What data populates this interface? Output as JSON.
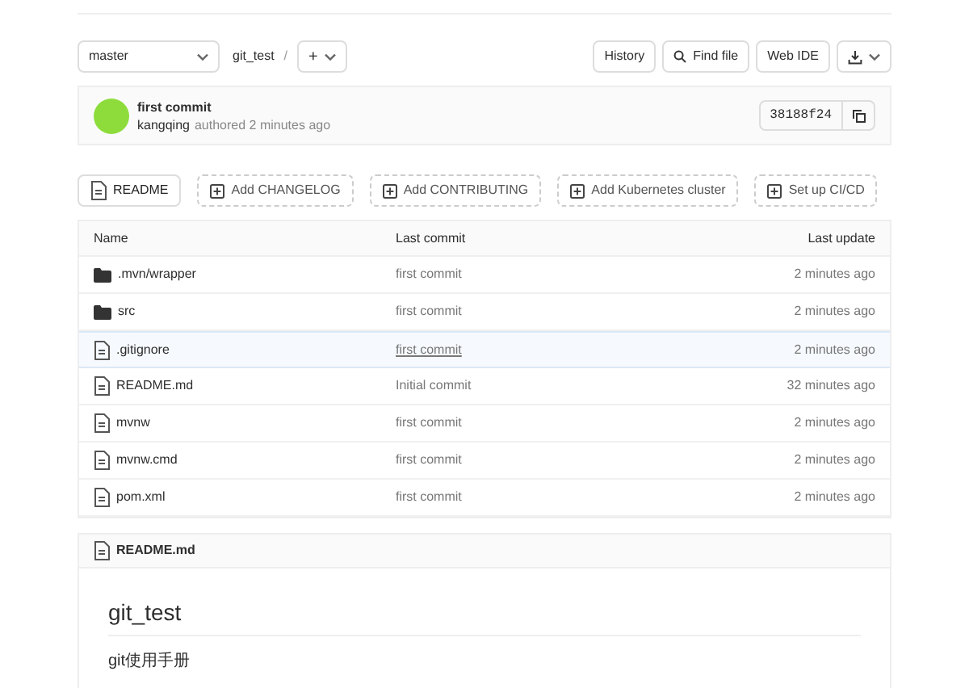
{
  "toolbar": {
    "branch": "master",
    "path": "git_test",
    "separator": "/",
    "add_button": "+",
    "buttons": [
      {
        "kind": "text",
        "label": "History"
      },
      {
        "kind": "search",
        "label": "Find file"
      },
      {
        "kind": "text",
        "label": "Web IDE"
      },
      {
        "kind": "download"
      }
    ]
  },
  "commit": {
    "title": "first commit",
    "author": "kangqing",
    "meta": "authored 2 minutes ago",
    "sha": "38188f24"
  },
  "actions": [
    {
      "kind": "existing",
      "label": "README"
    },
    {
      "kind": "add",
      "label": "Add CHANGELOG"
    },
    {
      "kind": "add",
      "label": "Add CONTRIBUTING"
    },
    {
      "kind": "add",
      "label": "Add Kubernetes cluster"
    },
    {
      "kind": "add",
      "label": "Set up CI/CD"
    }
  ],
  "table": {
    "columns": [
      "Name",
      "Last commit",
      "Last update"
    ],
    "rows": [
      {
        "kind": "folder",
        "name": ".mvn/wrapper",
        "commit": "first commit",
        "updated": "2 minutes ago",
        "highlighted": false
      },
      {
        "kind": "folder",
        "name": "src",
        "commit": "first commit",
        "updated": "2 minutes ago",
        "highlighted": false
      },
      {
        "kind": "file",
        "name": ".gitignore",
        "commit": "first commit",
        "updated": "2 minutes ago",
        "highlighted": true
      },
      {
        "kind": "file",
        "name": "README.md",
        "commit": "Initial commit",
        "updated": "32 minutes ago",
        "highlighted": false
      },
      {
        "kind": "file",
        "name": "mvnw",
        "commit": "first commit",
        "updated": "2 minutes ago",
        "highlighted": false
      },
      {
        "kind": "file",
        "name": "mvnw.cmd",
        "commit": "first commit",
        "updated": "2 minutes ago",
        "highlighted": false
      },
      {
        "kind": "file",
        "name": "pom.xml",
        "commit": "first commit",
        "updated": "2 minutes ago",
        "highlighted": false
      }
    ]
  },
  "readme": {
    "filename": "README.md",
    "heading": "git_test",
    "body": "git使用手册"
  }
}
